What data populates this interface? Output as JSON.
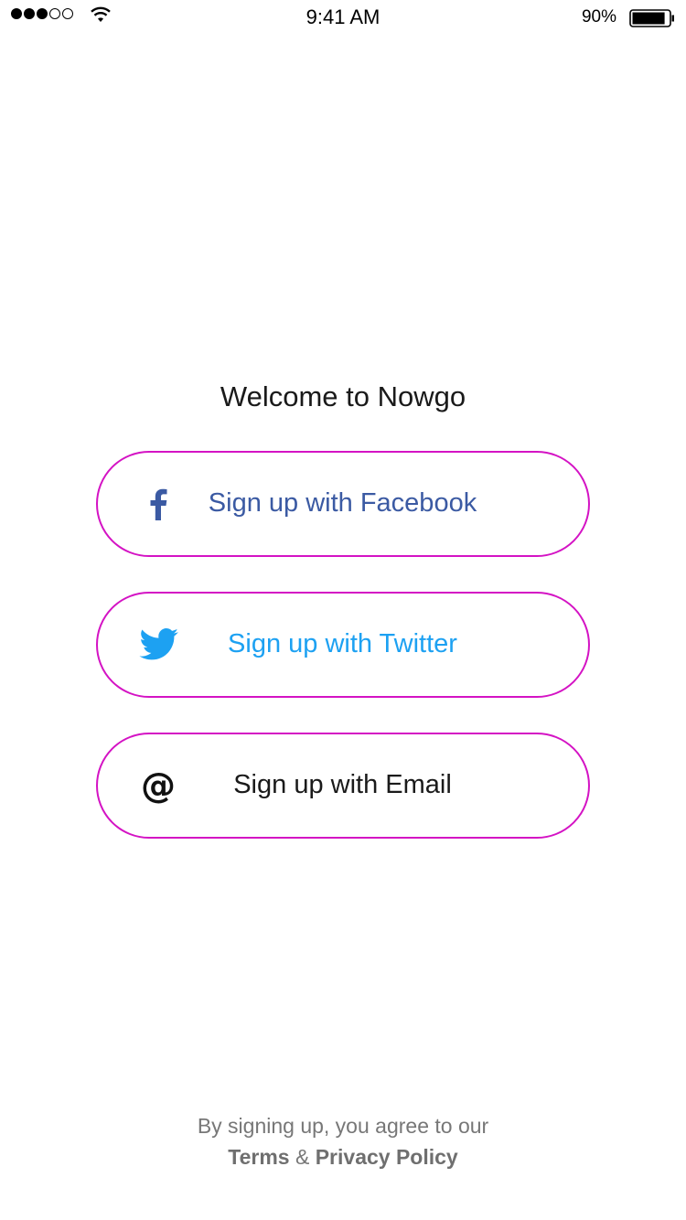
{
  "status_bar": {
    "signal_bars_filled": 3,
    "signal_bars_total": 5,
    "time": "9:41 AM",
    "battery_percent": "90%",
    "battery_level": 0.9
  },
  "welcome": {
    "title": "Welcome to Nowgo"
  },
  "buttons": {
    "facebook": {
      "label": "Sign up with Facebook",
      "icon": "facebook-icon",
      "color": "#3b5aa3"
    },
    "twitter": {
      "label": "Sign up with Twitter",
      "icon": "twitter-icon",
      "color": "#1da1f2"
    },
    "email": {
      "label": "Sign up with Email",
      "icon": "at-sign-icon",
      "glyph": "@",
      "color": "#1a1a1a"
    }
  },
  "button_border_color": "#d413c4",
  "footer": {
    "text": "By signing up, you agree to our",
    "terms_label": "Terms",
    "separator": "&",
    "privacy_label": "Privacy Policy"
  }
}
